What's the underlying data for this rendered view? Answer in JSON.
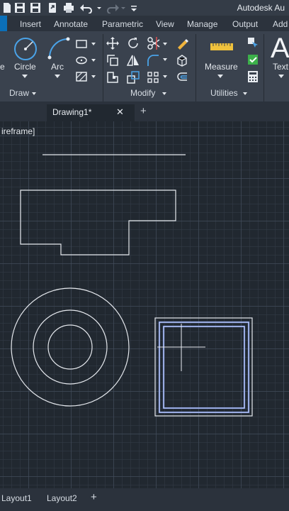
{
  "titlebar": {
    "app_title": "Autodesk Au"
  },
  "ribbon_tabs": [
    "Insert",
    "Annotate",
    "Parametric",
    "View",
    "Manage",
    "Output",
    "Add"
  ],
  "panels": {
    "draw": {
      "label": "Draw",
      "circle": "Circle",
      "arc": "Arc",
      "line_partial": "e"
    },
    "modify": {
      "label": "Modify"
    },
    "utilities": {
      "label": "Utilities",
      "measure": "Measure"
    },
    "text": {
      "label": "Text",
      "big_a": "A"
    }
  },
  "file_tab": {
    "name": "Drawing1*",
    "close": "✕",
    "new": "+"
  },
  "viewport": {
    "label": "ireframe]"
  },
  "layout_tabs": {
    "layout1": "Layout1",
    "layout2": "Layout2",
    "add": "+"
  },
  "colors": {
    "accent": "#0b6fb8",
    "canvas": "#212830",
    "geometry": "#e6e9ee",
    "selection": "#5a78d8"
  }
}
